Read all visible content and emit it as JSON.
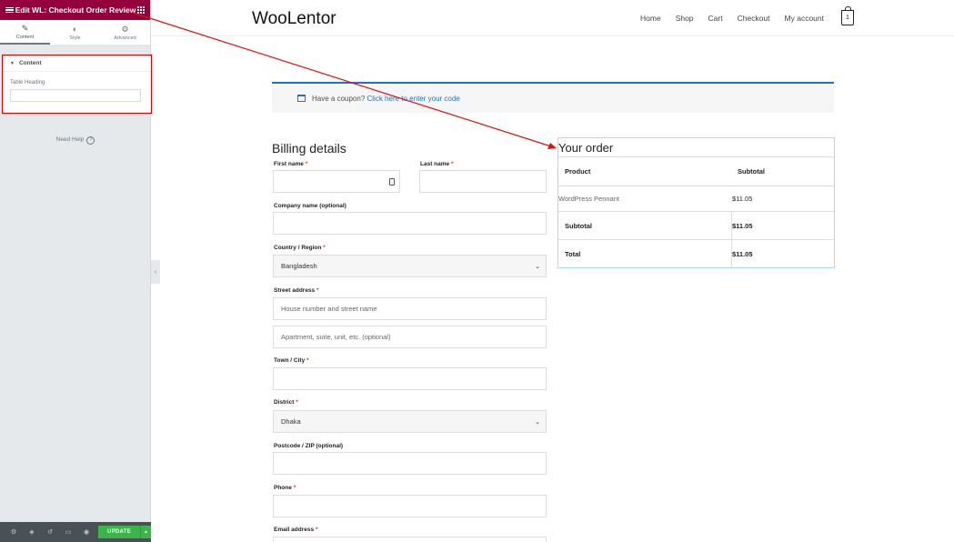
{
  "editor": {
    "title": "Edit WL: Checkout Order Review",
    "tabs": [
      {
        "label": "Content",
        "icon": "pencil-icon"
      },
      {
        "label": "Style",
        "icon": "contrast-icon"
      },
      {
        "label": "Advanced",
        "icon": "gear-icon"
      }
    ],
    "section_title": "Content",
    "control_label": "Table Heading",
    "control_value": "",
    "need_help": "Need Help",
    "update_label": "UPDATE",
    "brand_color": "#93003c",
    "update_color": "#39b54a"
  },
  "site": {
    "logo": "WooLentor",
    "nav": [
      "Home",
      "Shop",
      "Cart",
      "Checkout",
      "My account"
    ],
    "cart_count": "1",
    "coupon_text": "Have a coupon?",
    "coupon_link": "Click here to enter your code",
    "accent_color": "#1e73be"
  },
  "billing": {
    "title": "Billing details",
    "first_name_label": "First name",
    "last_name_label": "Last name",
    "company_label": "Company name (optional)",
    "country_label": "Country / Region",
    "country_value": "Bangladesh",
    "street_label": "Street address",
    "street_placeholder": "House number and street name",
    "street2_placeholder": "Apartment, suite, unit, etc. (optional)",
    "city_label": "Town / City",
    "district_label": "District",
    "district_value": "Dhaka",
    "postcode_label": "Postcode / ZIP (optional)",
    "phone_label": "Phone",
    "email_label": "Email address",
    "required_mark": "*"
  },
  "order": {
    "title": "Your order",
    "col_product": "Product",
    "col_subtotal": "Subtotal",
    "item_name": "WordPress Pennant",
    "item_price": "$11.05",
    "subtotal_label": "Subtotal",
    "subtotal_value": "$11.05",
    "total_label": "Total",
    "total_value": "$11.05"
  }
}
